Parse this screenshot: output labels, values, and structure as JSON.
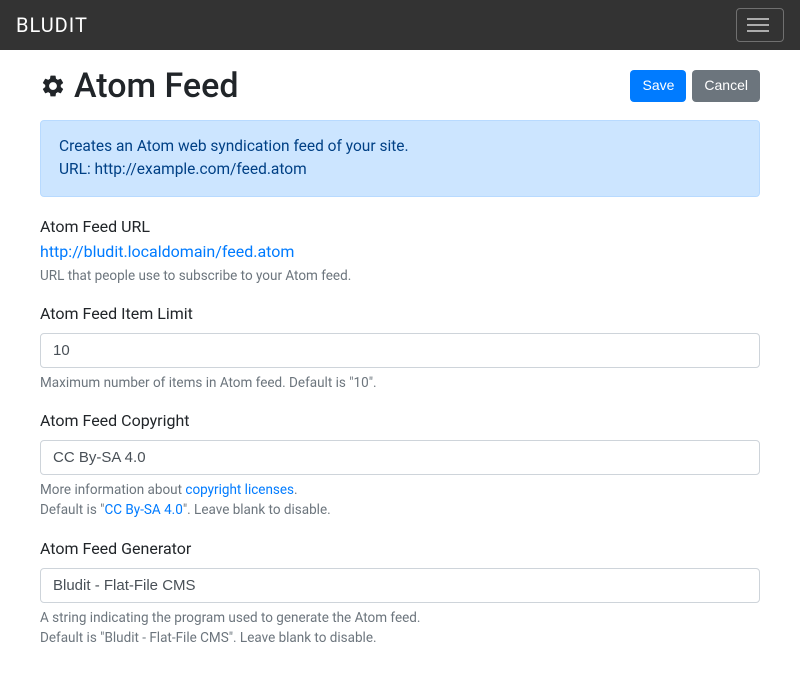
{
  "navbar": {
    "brand": "BLUDIT"
  },
  "header": {
    "title": "Atom Feed",
    "save": "Save",
    "cancel": "Cancel"
  },
  "alert": {
    "line1": "Creates an Atom web syndication feed of your site.",
    "line2": "URL: http://example.com/feed.atom"
  },
  "fields": {
    "url": {
      "label": "Atom Feed URL",
      "link": "http://bludit.localdomain/feed.atom",
      "help": "URL that people use to subscribe to your Atom feed."
    },
    "limit": {
      "label": "Atom Feed Item Limit",
      "value": "10",
      "help": "Maximum number of items in Atom feed. Default is \"10\"."
    },
    "copyright": {
      "label": "Atom Feed Copyright",
      "value": "CC By-SA 4.0",
      "help_prefix": "More information about ",
      "help_link": "copyright licenses",
      "help_suffix": ".",
      "help2_prefix": "Default is \"",
      "help2_link": "CC By-SA 4.0",
      "help2_suffix": "\". Leave blank to disable."
    },
    "generator": {
      "label": "Atom Feed Generator",
      "value": "Bludit - Flat-File CMS",
      "help1": "A string indicating the program used to generate the Atom feed.",
      "help2": "Default is \"Bludit - Flat-File CMS\". Leave blank to disable."
    }
  }
}
